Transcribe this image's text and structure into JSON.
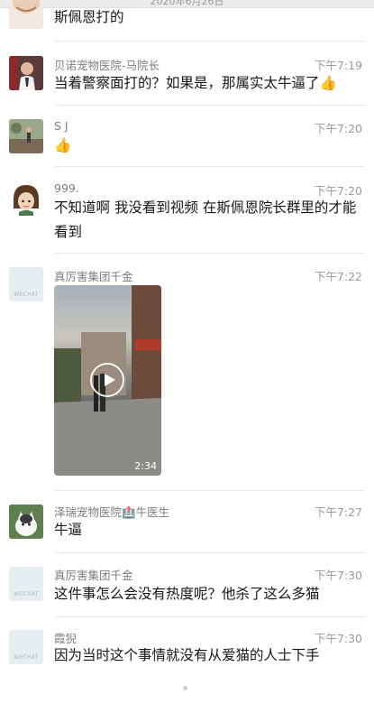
{
  "date_bar": "2020年6月26日",
  "messages": [
    {
      "name": "",
      "time": "",
      "text": "斯佩恩打的"
    },
    {
      "name": "贝诺宠物医院-马院长",
      "time": "下午7:19",
      "text": "当着警察面打的？如果是，那属实太牛逼了👍"
    },
    {
      "name": "S J",
      "time": "下午7:20",
      "text": "👍"
    },
    {
      "name": "999.",
      "time": "下午7:20",
      "text": "不知道啊 我没看到视频 在斯佩恩院长群里的才能看到"
    },
    {
      "name": "真厉害集团千金",
      "time": "下午7:22",
      "video_duration": "2:34"
    },
    {
      "name": "泽瑞宠物医院🏥牛医生",
      "time": "下午7:27",
      "text": "牛逼"
    },
    {
      "name": "真厉害集团千金",
      "time": "下午7:30",
      "text": "这件事怎么会没有热度呢？他杀了这么多猫"
    },
    {
      "name": "霞猊",
      "time": "下午7:30",
      "text": "因为当时这个事情就没有从爱猫的人士下手"
    }
  ],
  "placeholder_avatar_text": "WECHAT",
  "colors": {
    "name_gray": "#7d7d7d",
    "time_gray": "#9a9a9a",
    "text": "#161616",
    "divider": "#e9e9e9"
  }
}
